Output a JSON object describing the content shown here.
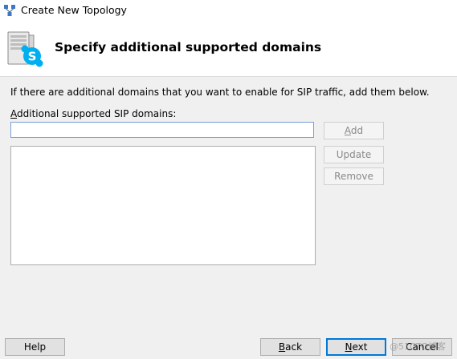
{
  "window": {
    "title": "Create New Topology",
    "app_icon": "topology-icon"
  },
  "header": {
    "icon": "skype-server-icon",
    "title": "Specify additional supported domains"
  },
  "main": {
    "description": "If there are additional domains that you want to enable for SIP traffic, add them below.",
    "field_label_mnemonic": "A",
    "field_label_rest": "dditional supported SIP domains:",
    "domain_input_value": "",
    "domains": []
  },
  "side_buttons": {
    "add_mnemonic": "A",
    "add_rest": "dd",
    "update_label": "Update",
    "remove_label": "Remove"
  },
  "footer": {
    "help_label": "Help",
    "back_mnemonic": "B",
    "back_rest": "ack",
    "next_mnemonic": "N",
    "next_rest": "ext",
    "cancel_label": "Cancel"
  },
  "watermark": "@51CTO博客",
  "colors": {
    "header_bg": "#ffffff",
    "body_bg": "#f0f0f0",
    "skype_blue": "#00aff0",
    "focus_border": "#0078d7"
  }
}
